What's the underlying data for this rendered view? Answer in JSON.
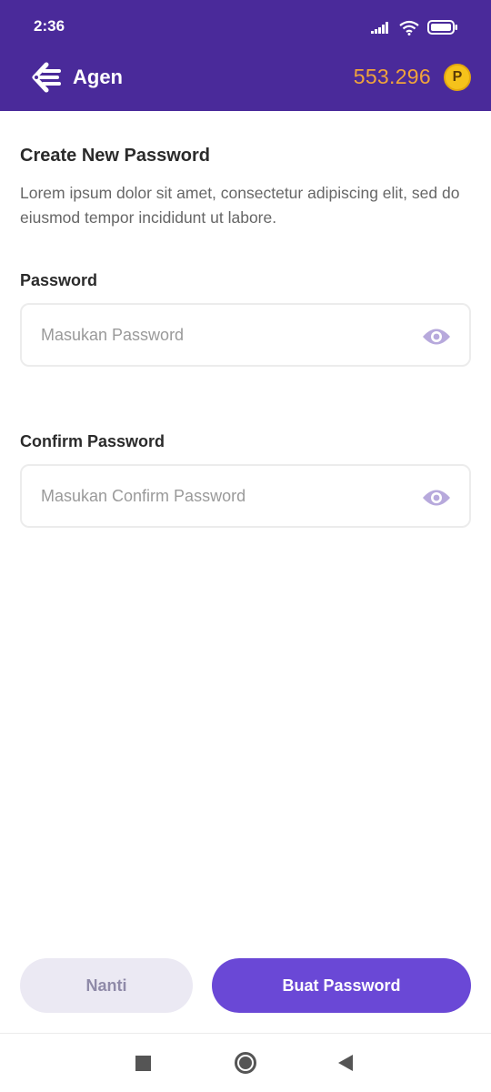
{
  "status_bar": {
    "time": "2:36",
    "icons": [
      "signal-icon",
      "wifi-icon",
      "battery-icon"
    ]
  },
  "app_bar": {
    "title": "Agen",
    "points": "553.296",
    "coin_label": "P",
    "colors": {
      "background": "#4a2a9a",
      "points": "#f0a33b",
      "coin": "#f5c21b"
    }
  },
  "form": {
    "heading": "Create New Password",
    "description": "Lorem ipsum dolor sit amet, consectetur adipiscing elit, sed do eiusmod tempor incididunt ut labore.",
    "password": {
      "label": "Password",
      "placeholder": "Masukan Password",
      "icon": "eye-icon"
    },
    "confirm_password": {
      "label": "Confirm Password",
      "placeholder": "Masukan Confirm Password",
      "icon": "eye-icon"
    }
  },
  "actions": {
    "later_label": "Nanti",
    "create_label": "Buat Password",
    "colors": {
      "primary": "#6a48d6",
      "secondary": "#ebe9f3"
    }
  },
  "nav_bar": {
    "icons": [
      "recents-icon",
      "home-icon",
      "back-icon"
    ]
  }
}
